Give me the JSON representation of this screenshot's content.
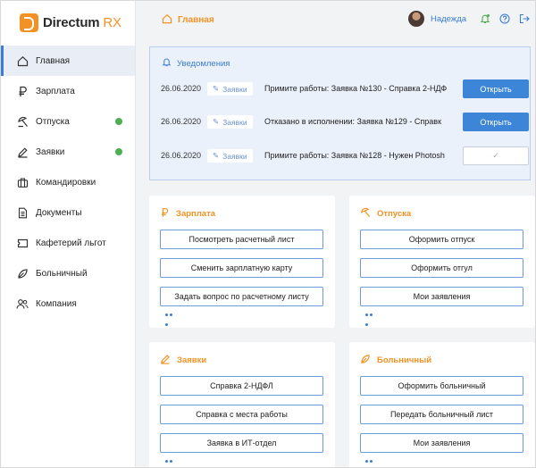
{
  "app": {
    "logo_brand": "Directum",
    "logo_suffix": "RX",
    "page_title": "Главная",
    "accent_color": "#f39224",
    "link_color": "#3c7dd0"
  },
  "sidebar": {
    "items": [
      {
        "label": "Главная",
        "icon": "home-icon",
        "active": true
      },
      {
        "label": "Зарплата",
        "icon": "ruble-icon"
      },
      {
        "label": "Отпуска",
        "icon": "beach-icon",
        "badge": true
      },
      {
        "label": "Заявки",
        "icon": "pen-icon",
        "badge": true
      },
      {
        "label": "Командировки",
        "icon": "suitcase-icon"
      },
      {
        "label": "Документы",
        "icon": "document-icon"
      },
      {
        "label": "Кафетерий льгот",
        "icon": "ticket-icon"
      },
      {
        "label": "Больничный",
        "icon": "pill-icon"
      },
      {
        "label": "Компания",
        "icon": "people-icon"
      }
    ]
  },
  "header": {
    "user_name": "Надежда",
    "icons": [
      "bell-icon",
      "help-icon",
      "logout-icon"
    ]
  },
  "notifications": {
    "title": "Уведомления",
    "rows": [
      {
        "date": "26.06.2020",
        "tag": "Заявки",
        "text": "Примите работы: Заявка №130 - Справка 2-НДФ",
        "button": "Открыть"
      },
      {
        "date": "26.06.2020",
        "tag": "Заявки",
        "text": "Отказано в исполнении: Заявка №129 - Справк",
        "button": "Открыть"
      },
      {
        "date": "26.06.2020",
        "tag": "Заявки",
        "text": "Примите работы: Заявка №128 - Нужен Photosh",
        "button": "✓"
      }
    ]
  },
  "cards": [
    {
      "title": "Зарплата",
      "icon": "ruble-icon",
      "buttons": [
        "Посмотреть расчетный лист",
        "Сменить зарплатную карту",
        "Задать вопрос по расчетному листу"
      ]
    },
    {
      "title": "Отпуска",
      "icon": "beach-icon",
      "buttons": [
        "Оформить отпуск",
        "Оформить отгул",
        "Мои заявления"
      ]
    },
    {
      "title": "Заявки",
      "icon": "pen-icon",
      "buttons": [
        "Справка 2-НДФЛ",
        "Справка с места работы",
        "Заявка в ИТ-отдел"
      ]
    },
    {
      "title": "Больничный",
      "icon": "pill-icon",
      "buttons": [
        "Оформить больничный",
        "Передать больничный лист",
        "Мои заявления"
      ]
    }
  ]
}
